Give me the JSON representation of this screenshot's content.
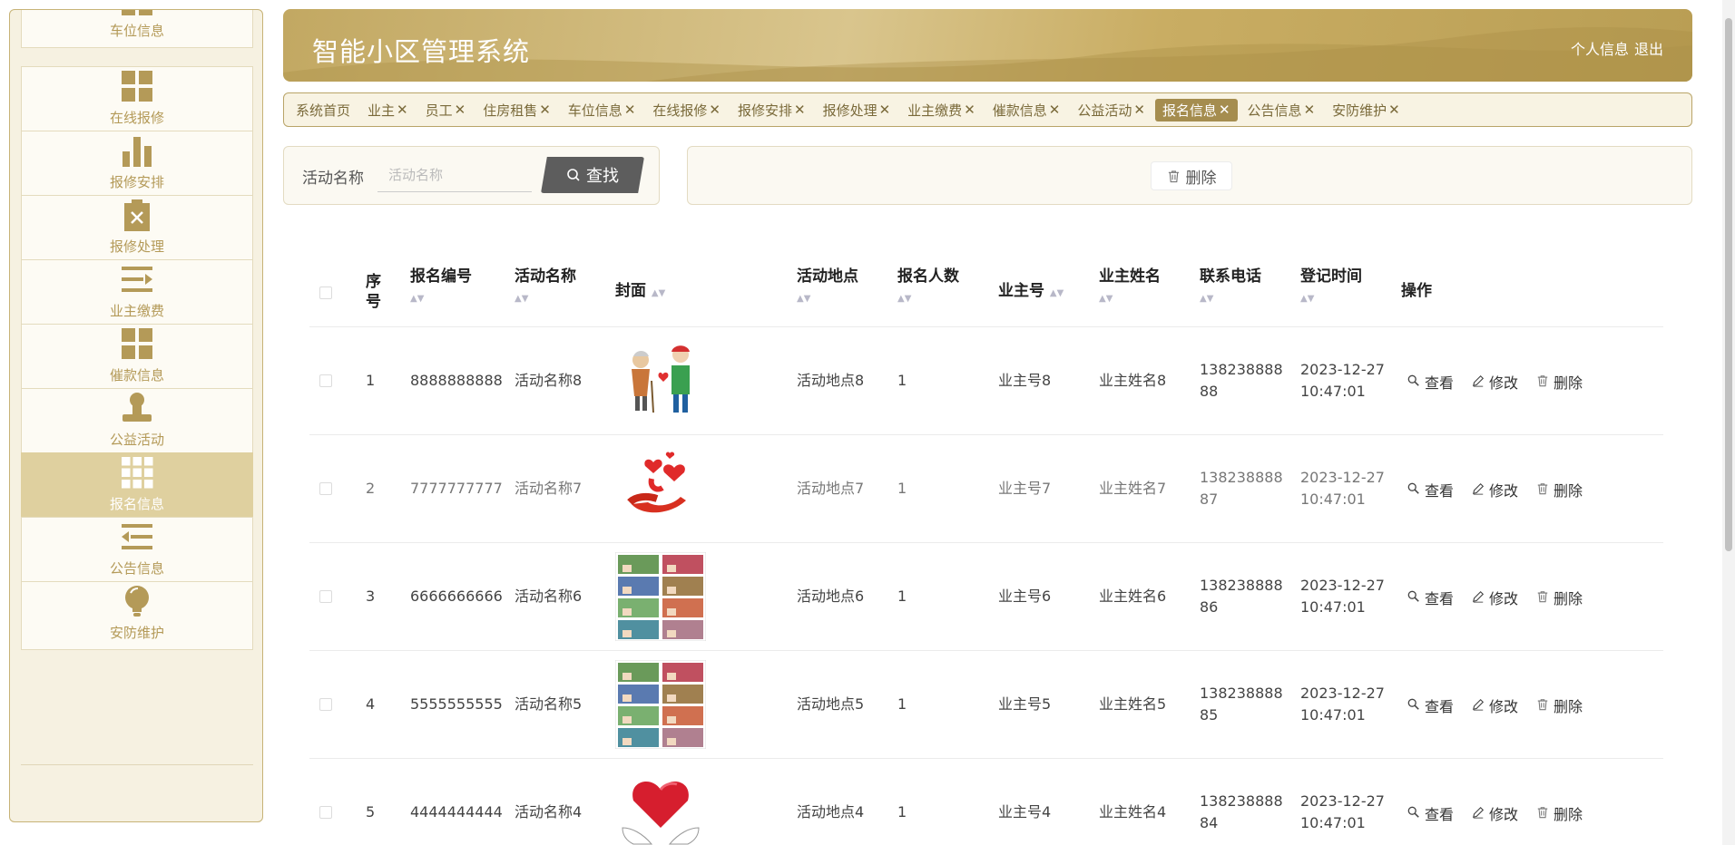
{
  "header": {
    "title": "智能小区管理系统",
    "profile_link": "个人信息",
    "logout_link": "退出"
  },
  "sidebar": {
    "items": [
      {
        "label": "车位信息",
        "icon": "grid-icon"
      },
      {
        "label": "在线报修",
        "icon": "grid-icon"
      },
      {
        "label": "报修安排",
        "icon": "bar-chart-icon"
      },
      {
        "label": "报修处理",
        "icon": "clipboard-x-icon"
      },
      {
        "label": "业主缴费",
        "icon": "lines-arrow-icon"
      },
      {
        "label": "催款信息",
        "icon": "grid-icon"
      },
      {
        "label": "公益活动",
        "icon": "stamp-icon"
      },
      {
        "label": "报名信息",
        "icon": "apps-icon",
        "active": true
      },
      {
        "label": "公告信息",
        "icon": "lines-back-icon"
      },
      {
        "label": "安防维护",
        "icon": "bulb-icon"
      }
    ]
  },
  "tabs": [
    {
      "label": "系统首页",
      "closable": false
    },
    {
      "label": "业主",
      "closable": true
    },
    {
      "label": "员工",
      "closable": true
    },
    {
      "label": "住房租售",
      "closable": true
    },
    {
      "label": "车位信息",
      "closable": true
    },
    {
      "label": "在线报修",
      "closable": true
    },
    {
      "label": "报修安排",
      "closable": true
    },
    {
      "label": "报修处理",
      "closable": true
    },
    {
      "label": "业主缴费",
      "closable": true
    },
    {
      "label": "催款信息",
      "closable": true
    },
    {
      "label": "公益活动",
      "closable": true
    },
    {
      "label": "报名信息",
      "closable": true,
      "active": true
    },
    {
      "label": "公告信息",
      "closable": true
    },
    {
      "label": "安防维护",
      "closable": true
    }
  ],
  "search": {
    "label": "活动名称",
    "placeholder": "活动名称",
    "value": "",
    "button_label": "查找"
  },
  "actions": {
    "delete_label": "删除"
  },
  "table": {
    "headers": {
      "index": "序号",
      "signup_no": "报名编号",
      "activity_name": "活动名称",
      "cover": "封面",
      "location": "活动地点",
      "count": "报名人数",
      "owner_no": "业主号",
      "owner_name": "业主姓名",
      "phone": "联系电话",
      "reg_time": "登记时间",
      "ops": "操作"
    },
    "op_labels": {
      "view": "查看",
      "edit": "修改",
      "delete": "删除"
    },
    "rows": [
      {
        "index": "1",
        "signup_no": "8888888888",
        "activity_name": "活动名称8",
        "cover": "elderly-helper-image",
        "location": "活动地点8",
        "count": "1",
        "owner_no": "业主号8",
        "owner_name": "业主姓名8",
        "phone_a": "138238888",
        "phone_b": "88",
        "date": "2023-12-27",
        "time": "10:47:01"
      },
      {
        "index": "2",
        "signup_no": "7777777777",
        "activity_name": "活动名称7",
        "cover": "hand-hearts-image",
        "location": "活动地点7",
        "count": "1",
        "owner_no": "业主号7",
        "owner_name": "业主姓名7",
        "phone_a": "138238888",
        "phone_b": "87",
        "date": "2023-12-27",
        "time": "10:47:01"
      },
      {
        "index": "3",
        "signup_no": "6666666666",
        "activity_name": "活动名称6",
        "cover": "photo-collage-image",
        "location": "活动地点6",
        "count": "1",
        "owner_no": "业主号6",
        "owner_name": "业主姓名6",
        "phone_a": "138238888",
        "phone_b": "86",
        "date": "2023-12-27",
        "time": "10:47:01"
      },
      {
        "index": "4",
        "signup_no": "5555555555",
        "activity_name": "活动名称5",
        "cover": "photo-collage-image",
        "location": "活动地点5",
        "count": "1",
        "owner_no": "业主号5",
        "owner_name": "业主姓名5",
        "phone_a": "138238888",
        "phone_b": "85",
        "date": "2023-12-27",
        "time": "10:47:01"
      },
      {
        "index": "5",
        "signup_no": "4444444444",
        "activity_name": "活动名称4",
        "cover": "heart-hands-image",
        "location": "活动地点4",
        "count": "1",
        "owner_no": "业主号4",
        "owner_name": "业主姓名4",
        "phone_a": "138238888",
        "phone_b": "84",
        "date": "2023-12-27",
        "time": "10:47:01"
      }
    ]
  },
  "colors": {
    "accent": "#b99e54",
    "sidebar_bg": "#f6f1e1",
    "active_item": "#dfd09f",
    "tab_active": "#a58d4f"
  }
}
